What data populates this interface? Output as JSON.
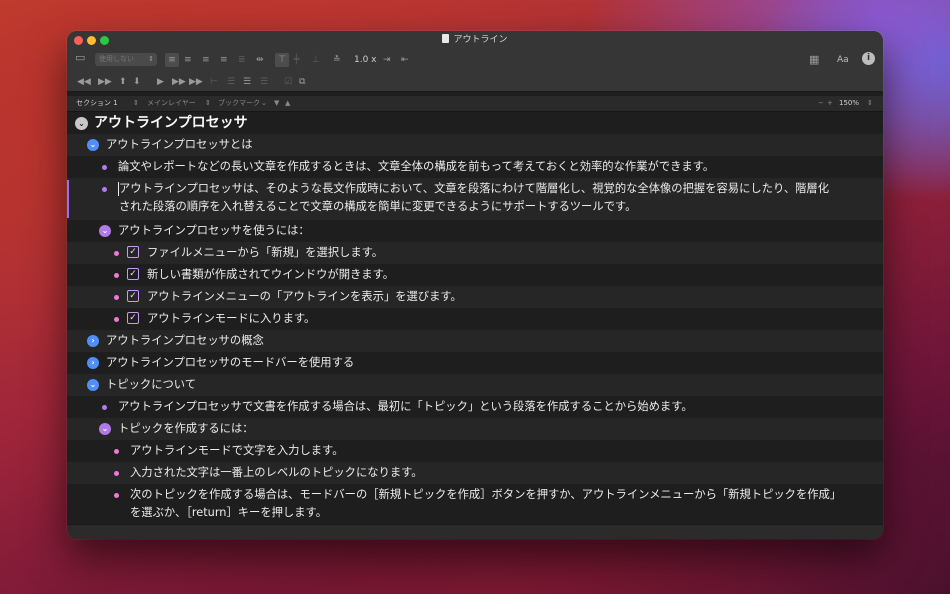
{
  "window": {
    "title": "アウトライン"
  },
  "toolbar": {
    "style_select": "使用しない",
    "spacing_value": "1.0 x",
    "font_button": "Aa",
    "info_button": "i"
  },
  "modebar": {
    "section": "セクション 1",
    "main_layer": "メインレイヤー",
    "bookmark": "ブックマーク",
    "zoom": "150%",
    "zoom_minus": "−",
    "zoom_plus": "+"
  },
  "outline": [
    {
      "level": 0,
      "kind": "disclosure",
      "state": "expanded",
      "color": "gray",
      "text": "アウトラインプロセッサ"
    },
    {
      "level": 1,
      "kind": "disclosure",
      "state": "expanded",
      "color": "blue",
      "text": "アウトラインプロセッサとは"
    },
    {
      "level": 2,
      "kind": "bullet",
      "color": "violet",
      "text": "論文やレポートなどの長い文章を作成するときは、文章全体の構成を前もって考えておくと効率的な作業ができます。"
    },
    {
      "level": 2,
      "kind": "bullet",
      "color": "violet",
      "focused": true,
      "line1": "アウトラインプロセッサは、そのような長文作成時において、文章を段落にわけて階層化し、視覚的な全体像の把握を容易にしたり、階層化",
      "line2": "された段落の順序を入れ替えることで文章の構成を簡単に変更できるようにサポートするツールです。"
    },
    {
      "level": 2,
      "kind": "disclosure",
      "state": "expanded",
      "color": "violet",
      "text": "アウトラインプロセッサを使うには："
    },
    {
      "level": 3,
      "kind": "check",
      "checked": true,
      "text": "ファイルメニューから「新規」を選択します。"
    },
    {
      "level": 3,
      "kind": "check",
      "checked": true,
      "text": "新しい書類が作成されてウインドウが開きます。"
    },
    {
      "level": 3,
      "kind": "check",
      "checked": true,
      "text": "アウトラインメニューの「アウトラインを表示」を選びます。"
    },
    {
      "level": 3,
      "kind": "check",
      "checked": true,
      "text": "アウトラインモードに入ります。"
    },
    {
      "level": 1,
      "kind": "disclosure",
      "state": "collapsed",
      "color": "blue",
      "text": "アウトラインプロセッサの概念"
    },
    {
      "level": 1,
      "kind": "disclosure",
      "state": "collapsed",
      "color": "blue",
      "text": "アウトラインプロセッサのモードバーを使用する"
    },
    {
      "level": 1,
      "kind": "disclosure",
      "state": "expanded",
      "color": "blue",
      "text": "トピックについて"
    },
    {
      "level": 2,
      "kind": "bullet",
      "color": "violet",
      "text": "アウトラインプロセッサで文書を作成する場合は、最初に「トピック」という段落を作成することから始めます。"
    },
    {
      "level": 2,
      "kind": "disclosure",
      "state": "expanded",
      "color": "violet",
      "text": "トピックを作成するには："
    },
    {
      "level": 3,
      "kind": "bullet",
      "color": "pink",
      "text": "アウトラインモードで文字を入力します。"
    },
    {
      "level": 3,
      "kind": "bullet",
      "color": "pink",
      "text": "入力された文字は一番上のレベルのトピックになります。"
    },
    {
      "level": 3,
      "kind": "bullet",
      "color": "pink",
      "line1": "次のトピックを作成する場合は、モードバーの［新規トピックを作成］ボタンを押すか、アウトラインメニューから「新規トピックを作成」",
      "line2": "を選ぶか、［return］キーを押します。"
    }
  ]
}
